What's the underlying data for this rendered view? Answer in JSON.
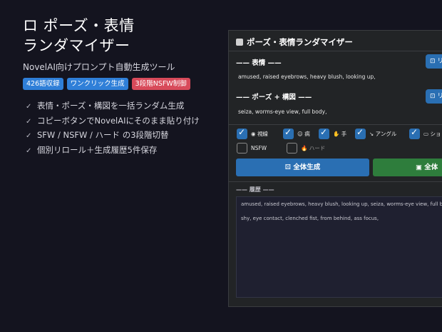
{
  "promo": {
    "title_line1": "ロ ポーズ・表情",
    "title_line2": "ランダマイザー",
    "subtitle": "NovelAI向けプロンプト自動生成ツール",
    "badges": [
      {
        "label": "426語収録",
        "color": "#2f7fd8"
      },
      {
        "label": "ワンクリック生成",
        "color": "#2f7fd8"
      },
      {
        "label": "3段階NSFW制御",
        "color": "#d84a5a"
      }
    ],
    "features": [
      "表情・ポーズ・構図を一括ランダム生成",
      "コピーボタンでNovelAIにそのまま貼り付け",
      "SFW / NSFW / ハード の3段階切替",
      "個別リロール＋生成履歴5件保存"
    ]
  },
  "app": {
    "header_title": "ポーズ・表情ランダマイザー",
    "expression": {
      "section_title": "—— 表情 ——",
      "reroll_label": "リ",
      "text": "amused, raised eyebrows, heavy blush, looking up,"
    },
    "pose": {
      "section_title": "—— ポーズ + 構図 ——",
      "reroll_label": "リ",
      "text": "seiza, worms-eye view, full body,"
    },
    "toggles_row1": [
      {
        "label": "視線",
        "checked": true
      },
      {
        "label": "病",
        "checked": true
      },
      {
        "label": "手",
        "checked": true
      },
      {
        "label": "アングル",
        "checked": true
      },
      {
        "label": "ショ",
        "checked": true
      }
    ],
    "toggles_row2": [
      {
        "label": "NSFW",
        "checked": false
      },
      {
        "label": "ハード",
        "checked": false
      }
    ],
    "generate_all_label": "全体生成",
    "copy_all_label": "全体",
    "history": {
      "section_title": "—— 履歴 ——",
      "entries": [
        "amused, raised eyebrows, heavy blush, looking up, seiza, worms-eye view, full body,",
        "shy, eye contact, clenched fist, from behind, ass focus,"
      ]
    },
    "colors": {
      "primary_button": "#2a6fb3",
      "copy_button": "#2e7d3c"
    }
  }
}
